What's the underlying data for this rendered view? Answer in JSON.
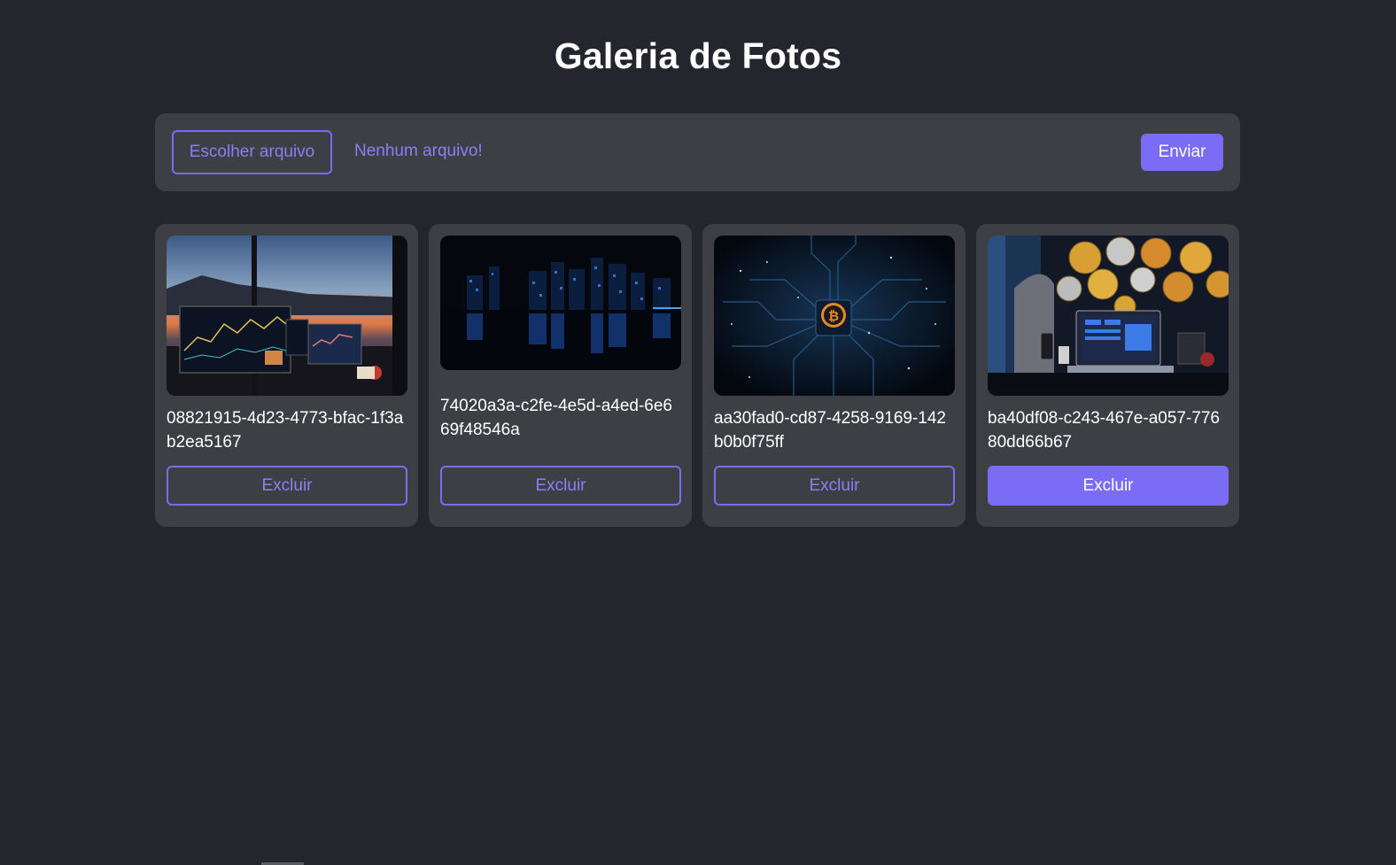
{
  "page": {
    "title": "Galeria de Fotos"
  },
  "upload": {
    "choose_label": "Escolher arquivo",
    "status_text": "Nenhum arquivo!",
    "send_label": "Enviar"
  },
  "colors": {
    "background": "#24252d",
    "panel": "#3e3f45",
    "accent": "#7b6cf6",
    "accent_text": "#8b7ff7",
    "text": "#ffffff"
  },
  "gallery": {
    "items": [
      {
        "caption": "08821915-4d23-4773-bfac-1f3ab2ea5167",
        "image": "trading-desk-sunset-photo",
        "delete_label": "Excluir",
        "delete_state": "default"
      },
      {
        "caption": "74020a3a-c2fe-4e5d-a4ed-6e669f48546a",
        "image": "night-city-skyline-photo",
        "delete_label": "Excluir",
        "delete_state": "default"
      },
      {
        "caption": "aa30fad0-cd87-4258-9169-142b0b0f75ff",
        "image": "bitcoin-circuit-board-photo",
        "delete_label": "Excluir",
        "delete_state": "default"
      },
      {
        "caption": "ba40df08-c243-467e-a057-77680dd66b67",
        "image": "crypto-coins-laptop-photo",
        "delete_label": "Excluir",
        "delete_state": "hover"
      }
    ]
  }
}
